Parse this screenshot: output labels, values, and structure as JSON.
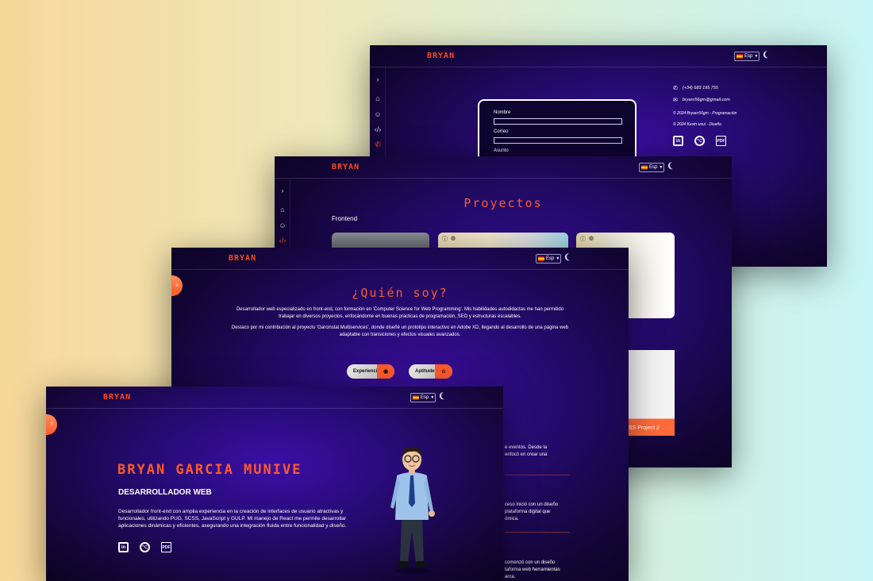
{
  "brand": {
    "logo": "BRYAN",
    "accent": "#ff4a1c"
  },
  "header": {
    "language": "Esp",
    "flag_icon": "spain-flag-icon",
    "theme_icon": "moon-icon"
  },
  "sidebar": {
    "icons": [
      "chevron-right-icon",
      "home-icon",
      "user-icon",
      "code-icon",
      "phone-icon"
    ]
  },
  "contact": {
    "form": {
      "name_label": "Nombre",
      "email_label": "Correo",
      "subject_label": "Asunto"
    },
    "phone": "(+34) 683 195 755",
    "email": "bryanr56gm@gmail.com",
    "credits": [
      "© 2024 Bryanr56gm - Programación",
      "© 2024 Kevin-usui - Diseño"
    ]
  },
  "projects": {
    "title": "Proyectos",
    "section": "Frontend",
    "card_label": "SS Project 2"
  },
  "about": {
    "title": "¿Quién soy?",
    "paragraph1": "Desarrollador web especializado en front-end, con formación en 'Computer Science for Web Programming'. Mis habilidades autodidactas me han permitido trabajar en diversos proyectos, enfocándome en buenas prácticas de programación, SEO y estructuras escalables.",
    "paragraph2": "Destaco por mi contribución al proyecto 'Garcinstal Multiservices', donde diseñé un prototipo interactivo en Adobe XD, llegando al desarrollo de una página web adaptable con transiciones y efectos visuales avanzados.",
    "buttons": {
      "experience": "Experiencia",
      "skills": "Aptitudes"
    },
    "timeline": [
      {
        "line1": "e eventos. Desde la",
        "line2": "enfocó en crear una"
      },
      {
        "line1": "ceso inició con un diseño",
        "line2": "plataforma digital que",
        "line3": "ómica."
      },
      {
        "line1": "comenzó con un diseño",
        "line2": "taforma web herramientas",
        "line3": "arca."
      }
    ]
  },
  "hero": {
    "name": "BRYAN GARCIA MUNIVE",
    "role": "DESARROLLADOR WEB",
    "description": "Desarrollador front-end con amplia experiencia en la creación de interfaces de usuario atractivas y funcionales, utilizando PUG, SCSS, JavaScript y GULP. Mi manejo de React me permite desarrollar aplicaciones dinámicas y eficientes, asegurando una integración fluida entre funcionalidad y diseño.",
    "social": {
      "linkedin": "in",
      "github": "gh",
      "cv": "pdf"
    }
  }
}
